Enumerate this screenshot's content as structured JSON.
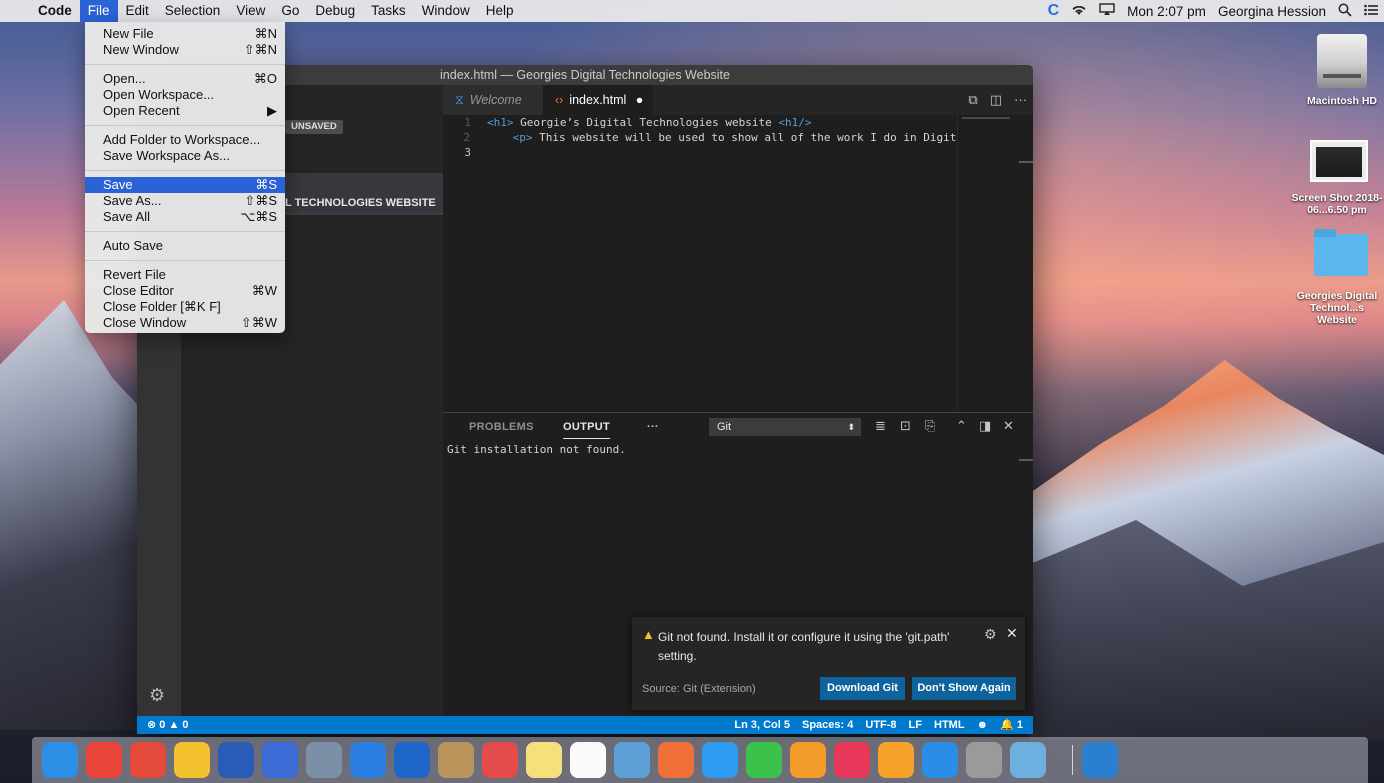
{
  "menubar": {
    "app": "Code",
    "items": [
      "File",
      "Edit",
      "Selection",
      "View",
      "Go",
      "Debug",
      "Tasks",
      "Window",
      "Help"
    ],
    "clock": "Mon 2:07 pm",
    "user": "Georgina Hession"
  },
  "file_menu": {
    "groups": [
      [
        {
          "label": "New File",
          "shortcut": "⌘N"
        },
        {
          "label": "New Window",
          "shortcut": "⇧⌘N"
        }
      ],
      [
        {
          "label": "Open...",
          "shortcut": "⌘O"
        },
        {
          "label": "Open Workspace...",
          "shortcut": ""
        },
        {
          "label": "Open Recent",
          "shortcut": "▶"
        }
      ],
      [
        {
          "label": "Add Folder to Workspace...",
          "shortcut": ""
        },
        {
          "label": "Save Workspace As...",
          "shortcut": ""
        }
      ],
      [
        {
          "label": "Save",
          "shortcut": "⌘S"
        },
        {
          "label": "Save As...",
          "shortcut": "⇧⌘S"
        },
        {
          "label": "Save All",
          "shortcut": "⌥⌘S"
        }
      ],
      [
        {
          "label": "Auto Save",
          "shortcut": ""
        }
      ],
      [
        {
          "label": "Revert File",
          "shortcut": ""
        },
        {
          "label": "Close Editor",
          "shortcut": "⌘W"
        },
        {
          "label": "Close Folder [⌘K F]",
          "shortcut": ""
        },
        {
          "label": "Close Window",
          "shortcut": "⇧⌘W"
        }
      ]
    ],
    "selected": "Save"
  },
  "window": {
    "title": "index.html — Georgies Digital Technologies Website"
  },
  "sidebar": {
    "unsaved_badge": "UNSAVED",
    "project_label": "L TECHNOLOGIES WEBSITE"
  },
  "tabs": [
    {
      "label": "Welcome",
      "icon": "vscode-icon"
    },
    {
      "label": "index.html",
      "icon": "html-icon",
      "dirty": "●"
    }
  ],
  "editor": {
    "lines": [
      {
        "num": "1",
        "open_tag": "<h1>",
        "text": " Georgie’s Digital Technologies website ",
        "close_tag": "<h1/>"
      },
      {
        "num": "2",
        "open_tag": "    <p>",
        "text": " This website will be used to show all of the work I do in Digita",
        "close_tag": ""
      },
      {
        "num": "3",
        "open_tag": "",
        "text": "",
        "close_tag": ""
      }
    ]
  },
  "panel": {
    "tabs": [
      "PROBLEMS",
      "OUTPUT",
      "···"
    ],
    "channel": "Git",
    "output": "Git installation not found."
  },
  "statusbar": {
    "left": "⊗ 0 ▲ 0",
    "position": "Ln 3, Col 5",
    "spaces": "Spaces: 4",
    "encoding": "UTF-8",
    "eol": "LF",
    "language": "HTML",
    "smiley": "☻",
    "bell": "🔔 1"
  },
  "notification": {
    "message": "Git not found. Install it or configure it using the 'git.path' setting.",
    "source": "Source: Git (Extension)",
    "primary": "Download Git",
    "secondary": "Don't Show Again"
  },
  "desktop": [
    {
      "label": "Macintosh HD"
    },
    {
      "label": "Screen Shot 2018-06...6.50 pm"
    },
    {
      "label": "Georgies Digital Technol...s Website"
    }
  ],
  "dock_colors": [
    "#2b8fe6",
    "#e9443a",
    "#e34a3c",
    "#f3c12f",
    "#2b5bb8",
    "#3a6bd6",
    "#7b8fa6",
    "#2a7fe0",
    "#1e66c8",
    "#b8945a",
    "#e44b4b",
    "#f6e07a",
    "#fafafa",
    "#5fa0d8",
    "#f0703a",
    "#2e9bf0",
    "#3ac24a",
    "#f29b2b",
    "#e8385a",
    "#f7a12a",
    "#2a8de6",
    "#9a9a9a",
    "#6db0e0",
    "#2a7fd0"
  ]
}
